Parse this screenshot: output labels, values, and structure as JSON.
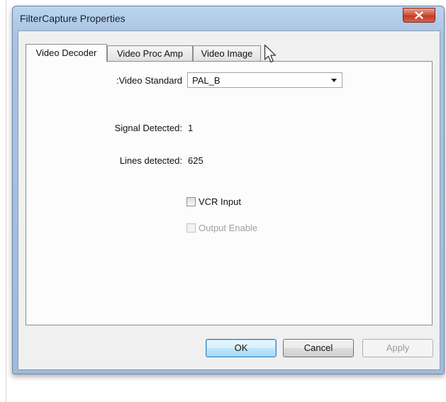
{
  "window": {
    "title": "FilterCapture Properties",
    "close_icon": "close-x-icon"
  },
  "tabs": [
    {
      "label": "Video Decoder",
      "active": true
    },
    {
      "label": "Video Proc Amp",
      "active": false
    },
    {
      "label": "Video Image",
      "active": false
    }
  ],
  "decoder": {
    "standard_label": ":Video Standard",
    "standard_value": "PAL_B",
    "signal_label": "Signal Detected:",
    "signal_value": "1",
    "lines_label": "Lines detected:",
    "lines_value": "625",
    "vcr_label": "VCR Input",
    "vcr_checked": false,
    "output_label": "Output Enable",
    "output_enabled": false
  },
  "buttons": {
    "ok": "OK",
    "cancel": "Cancel",
    "apply": "Apply"
  },
  "colors": {
    "title_bar": "#a9c4e2",
    "close_button": "#c23c24",
    "default_button_border": "#3c7fb1"
  }
}
